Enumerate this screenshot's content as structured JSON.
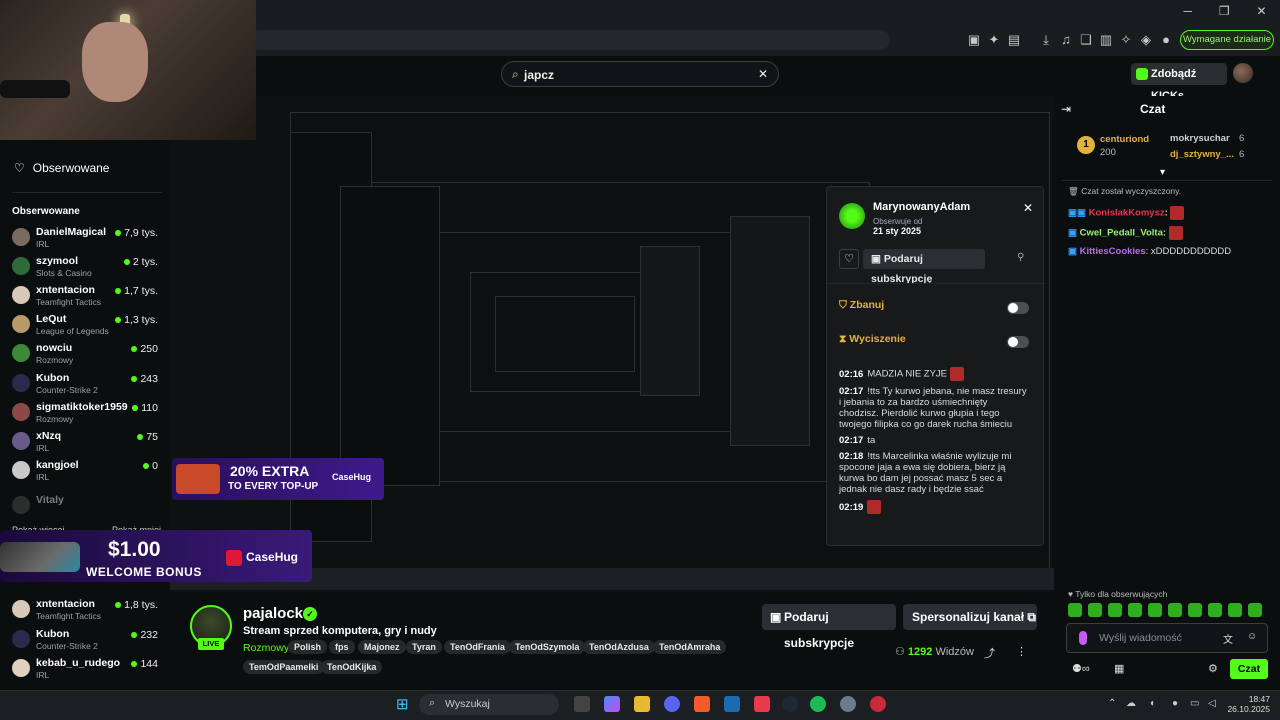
{
  "browser": {
    "required_action": "Wymagane działanie",
    "window_min": "─",
    "window_max": "❐",
    "window_close": "✕"
  },
  "header": {
    "search_value": "japcz",
    "kicks_button": "Zdobądź KICKs"
  },
  "sidebar": {
    "top_item": "Obserwowane",
    "section_label": "Obserwowane",
    "channels": [
      {
        "name": "DanielMagical",
        "category": "IRL",
        "viewers": "7,9 tys."
      },
      {
        "name": "szymool",
        "category": "Slots & Casino",
        "viewers": "2 tys."
      },
      {
        "name": "xntentacion",
        "category": "Teamfight Tactics",
        "viewers": "1,7 tys."
      },
      {
        "name": "LeQut",
        "category": "League of Legends",
        "viewers": "1,3 tys."
      },
      {
        "name": "nowciu",
        "category": "Rozmowy",
        "viewers": "250"
      },
      {
        "name": "Kubon",
        "category": "Counter-Strike 2",
        "viewers": "243"
      },
      {
        "name": "sigmatiktoker1959",
        "category": "Rozmowy",
        "viewers": "110"
      },
      {
        "name": "xNzq",
        "category": "IRL",
        "viewers": "75"
      },
      {
        "name": "kangjoel",
        "category": "IRL",
        "viewers": "0"
      },
      {
        "name": "Vitaly",
        "category": "",
        "viewers": ""
      }
    ],
    "show_more": "Pokaż więcej",
    "show_less": "Pokaż mniej",
    "recommended": [
      {
        "name": "xntentacion",
        "category": "Teamfight Tactics",
        "viewers": "1,8 tys."
      },
      {
        "name": "Kubon",
        "category": "Counter-Strike 2",
        "viewers": "232"
      },
      {
        "name": "kebab_u_rudego",
        "category": "IRL",
        "viewers": "144"
      }
    ]
  },
  "user_card": {
    "username": "MarynowanyAdam",
    "followed_since_label": "Obserwuje od",
    "followed_since": "21 sty 2025",
    "gift_sub": "Podaruj subskrypcję",
    "ban_label": "Zbanuj",
    "mute_label": "Wyciszenie",
    "log": [
      {
        "time": "02:16",
        "text": "MADZIA NIE ZYJE"
      },
      {
        "time": "02:17",
        "text": "!tts Ty kurwo jebana, nie masz tresury i jebania to za bardzo uśmiechnięty chodzisz. Pierdolić kurwo głupia i tego twojego filipka co go darek rucha śmieciu"
      },
      {
        "time": "02:17",
        "text": "ta"
      },
      {
        "time": "02:18",
        "text": "!tts Marcelinka właśnie wylizuje mi spocone jaja a ewa się dobiera, bierz ją kurwa bo dam jej possać masz 5 sec a jednak nie dasz rady i będzie ssać"
      },
      {
        "time": "02:19",
        "text": ""
      }
    ]
  },
  "promos": {
    "extra_pct": "20% EXTRA",
    "extra_sub": "TO EVERY TOP-UP",
    "bonus_amount": "$1.00",
    "bonus_sub": "WELCOME BONUS",
    "brand": "CaseHug"
  },
  "stream": {
    "live": "LIVE",
    "streamer": "pajalock",
    "title": "Stream sprzed komputera, gry i nudy",
    "category": "Rozmowy",
    "tags": [
      "Polish",
      "fps",
      "Majonez",
      "Tyran",
      "TenOdFrania",
      "TenOdSzymola",
      "TenOdAzdusa",
      "TenOdAmraha",
      "TemOdPaamelki",
      "TenOdKijka"
    ],
    "gift_button": "Podaruj subskrypcje",
    "customize_button": "Spersonalizuj kanał",
    "viewers_count": "1292",
    "viewers_label": "Widzów"
  },
  "chat": {
    "title": "Czat",
    "leaderboard": [
      {
        "name": "centuriond",
        "value": "200",
        "color": "#e3b23c"
      },
      {
        "name": "mokrysuchar",
        "value": "6",
        "color": "#d0d0d0"
      },
      {
        "name": "dj_sztywny_...",
        "value": "6",
        "color": "#e3b23c"
      }
    ],
    "cleared": "Czat został wyczyszczony.",
    "messages": [
      {
        "user": "KonislakKomysz",
        "text": ":",
        "color": "#e8344e"
      },
      {
        "user": "Cwel_Pedall_Volta",
        "text": ":",
        "color": "#9bf27a"
      },
      {
        "user": "KittiesCookies",
        "text": ": xDDDDDDDDDDD",
        "color": "#b86cf5"
      }
    ],
    "followers_only": "Tylko dla obserwujących",
    "input_placeholder": "Wyślij wiadomość",
    "send": "Czat"
  },
  "taskbar": {
    "search": "Wyszukaj",
    "time": "18:47",
    "date": "26.10.2025"
  }
}
